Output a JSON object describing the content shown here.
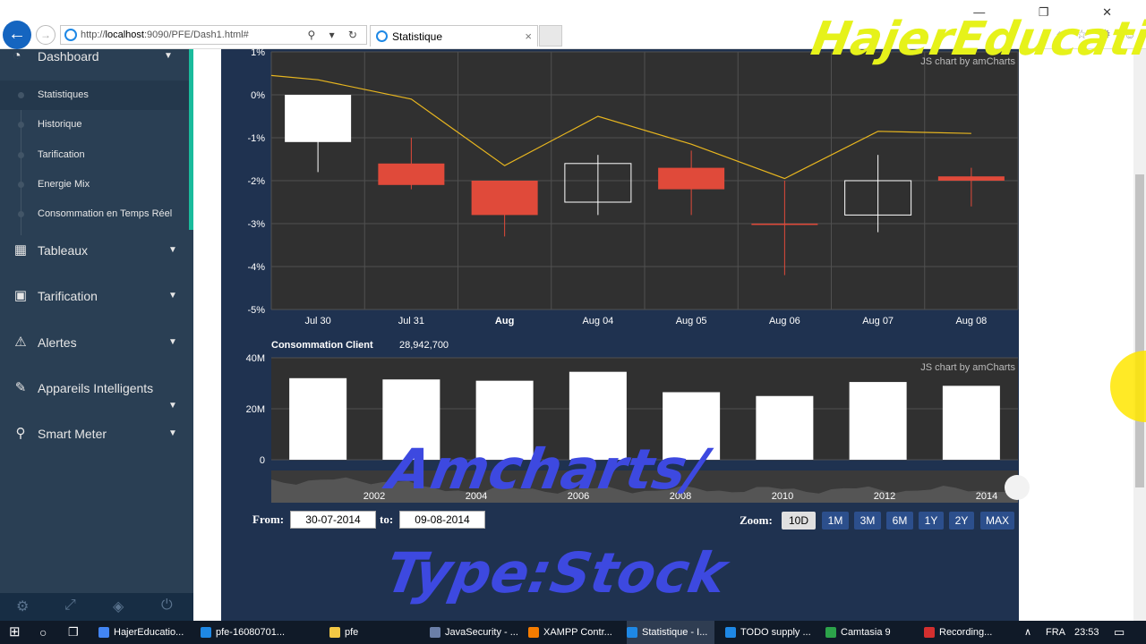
{
  "browser": {
    "url_prefix": "http://",
    "url_host": "localhost",
    "url_rest": ":9090/PFE/Dash1.html#",
    "tab_title": "Statistique",
    "tab_close": "×",
    "win_controls": "— ❐ ✕",
    "fav_icons": "⌂ ☆ ⚙ ☺",
    "addr_tools": "⚲ ▾ ↻"
  },
  "sidebar": {
    "dashboard": "Dashboard",
    "sub_items": [
      "Statistiques",
      "Historique",
      "Tarification",
      "Energie Mix",
      "Consommation en Temps Réel"
    ],
    "main_items": [
      "Tableaux",
      "Tarification",
      "Alertes",
      "Appareils Intelligents",
      "Smart Meter"
    ],
    "chevron": "▼"
  },
  "watermark": "HajerEducation",
  "overlay": {
    "line1": "Amcharts/",
    "line2": "Type:Stock"
  },
  "credits": "JS chart by amCharts",
  "controls": {
    "from_label": "From:",
    "from_value": "30-07-2014",
    "to_label": "to:",
    "to_value": "09-08-2014",
    "zoom_label": "Zoom:",
    "zoom_buttons": [
      "10D",
      "1M",
      "3M",
      "6M",
      "1Y",
      "2Y",
      "MAX"
    ],
    "zoom_active": "10D"
  },
  "chart_data": [
    {
      "type": "candlestick",
      "x": [
        "Jul 30",
        "Jul 31",
        "Aug",
        "Aug 04",
        "Aug 05",
        "Aug 06",
        "Aug 07",
        "Aug 08"
      ],
      "bold_labels": [
        "Aug"
      ],
      "ylim": [
        -5,
        1
      ],
      "yticks": [
        "1%",
        "0%",
        "-1%",
        "-2%",
        "-3%",
        "-4%",
        "-5%"
      ],
      "candles": [
        {
          "open": 0.0,
          "close": -1.1,
          "high": 0.0,
          "low": -1.8,
          "dir": "up"
        },
        {
          "open": -1.6,
          "close": -2.1,
          "high": -1.0,
          "low": -2.2,
          "dir": "down"
        },
        {
          "open": -2.0,
          "close": -2.8,
          "high": -2.0,
          "low": -3.3,
          "dir": "down"
        },
        {
          "open": -1.6,
          "close": -2.5,
          "high": -1.4,
          "low": -2.8,
          "dir": "up"
        },
        {
          "open": -1.7,
          "close": -2.2,
          "high": -1.3,
          "low": -2.8,
          "dir": "down"
        },
        {
          "open": -3.0,
          "close": -3.0,
          "high": -2.0,
          "low": -4.2,
          "dir": "down"
        },
        {
          "open": -2.0,
          "close": -2.8,
          "high": -1.4,
          "low": -3.2,
          "dir": "up"
        },
        {
          "open": -1.9,
          "close": -2.0,
          "high": -1.7,
          "low": -2.6,
          "dir": "down"
        }
      ],
      "line": [
        0.35,
        -0.1,
        -1.65,
        -0.5,
        -1.15,
        -1.95,
        -0.85,
        -0.9
      ],
      "colors": {
        "up": "#ffffff",
        "down": "#e04a3a",
        "line": "#e8b61f",
        "bg": "#303030",
        "grid": "#505050"
      }
    },
    {
      "type": "bar",
      "title": "Consommation Client",
      "value_label": "28,942,700",
      "categories": [
        "Jul 30",
        "Jul 31",
        "Aug",
        "Aug 04",
        "Aug 05",
        "Aug 06",
        "Aug 07",
        "Aug 08"
      ],
      "values": [
        32,
        31.5,
        31,
        34.5,
        26.5,
        25,
        30.5,
        29
      ],
      "ylim": [
        0,
        40
      ],
      "yticks": [
        "40M",
        "20M",
        "0"
      ],
      "color": "#ffffff"
    },
    {
      "type": "area",
      "role": "scrollbar",
      "x_labels": [
        "2002",
        "2004",
        "2006",
        "2008",
        "2010",
        "2012",
        "2014"
      ]
    }
  ],
  "taskbar": {
    "items": [
      "HajerEducatio...",
      "pfe-16080701...",
      "pfe",
      "JavaSecurity - ...",
      "XAMPP Contr...",
      "Statistique - I...",
      "TODO supply ...",
      "Camtasia 9",
      "Recording..."
    ],
    "lang": "FRA",
    "time": "23:53"
  }
}
